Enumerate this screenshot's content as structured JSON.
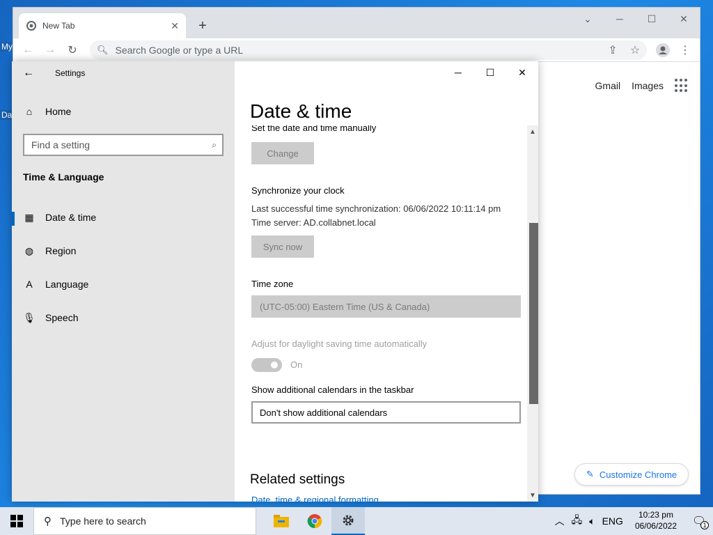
{
  "desktop": {
    "label1": "My",
    "label2": "Da"
  },
  "chrome": {
    "tab_title": "New Tab",
    "tab_close": "✕",
    "new_tab": "+",
    "omnibox_placeholder": "Search Google or type a URL",
    "gmail": "Gmail",
    "images": "Images",
    "customize": "Customize Chrome"
  },
  "settings": {
    "app_title": "Settings",
    "home": "Home",
    "search_placeholder": "Find a setting",
    "group": "Time & Language",
    "nav": [
      "Date & time",
      "Region",
      "Language",
      "Speech"
    ],
    "page_title": "Date & time",
    "set_manual_label": "Set the date and time manually",
    "change_btn": "Change",
    "sync_header": "Synchronize your clock",
    "last_sync": "Last successful time synchronization: 06/06/2022 10:11:14 pm",
    "time_server": "Time server: AD.collabnet.local",
    "sync_btn": "Sync now",
    "tz_header": "Time zone",
    "tz_value": "(UTC-05:00) Eastern Time (US & Canada)",
    "dst_label": "Adjust for daylight saving time automatically",
    "dst_state": "On",
    "cal_header": "Show additional calendars in the taskbar",
    "cal_value": "Don't show additional calendars",
    "related": "Related settings",
    "related_link": "Date, time & regional formatting"
  },
  "taskbar": {
    "search_placeholder": "Type here to search",
    "lang": "ENG",
    "time": "10:23 pm",
    "date": "06/06/2022",
    "notif_count": "1"
  }
}
